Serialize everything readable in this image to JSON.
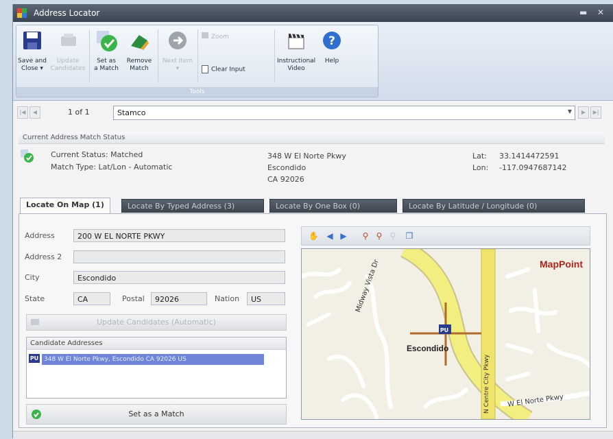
{
  "window": {
    "title": "Address Locator"
  },
  "ribbon": {
    "buttons": [
      {
        "label1": "Save and",
        "label2": "Close ▾"
      },
      {
        "label1": "Update",
        "label2": "Candidates"
      },
      {
        "label1": "Set as",
        "label2": "a Match"
      },
      {
        "label1": "Remove",
        "label2": "Match"
      },
      {
        "label1": "Next Item",
        "label2": "▾"
      },
      {
        "label1": "Instructional",
        "label2": "Video"
      },
      {
        "label1": "Help",
        "label2": ""
      }
    ],
    "zoom_label": "Zoom",
    "clear_input_label": "Clear Input",
    "group_label": "Tools"
  },
  "nav": {
    "pager": "1 of 1",
    "record": "Stamco"
  },
  "status": {
    "section_title": "Current Address Match Status",
    "current_status": "Current Status: Matched",
    "match_type": "Match Type: Lat/Lon - Automatic",
    "addr_line1": "348 W El Norte Pkwy",
    "addr_line2": "Escondido",
    "addr_line3": "CA 92026",
    "lat_label": "Lat:",
    "lat_value": "33.1414472591",
    "lon_label": "Lon:",
    "lon_value": "-117.0947687142"
  },
  "tabs": [
    "Locate On Map (1)",
    "Locate By Typed Address (3)",
    "Locate By One Box (0)",
    "Locate By Latitude / Longitude (0)"
  ],
  "form": {
    "address_label": "Address",
    "address_value": "200 W EL NORTE PKWY",
    "address2_label": "Address 2",
    "address2_value": "",
    "city_label": "City",
    "city_value": "Escondido",
    "state_label": "State",
    "state_value": "CA",
    "postal_label": "Postal",
    "postal_value": "92026",
    "nation_label": "Nation",
    "nation_value": "US",
    "update_button": "Update Candidates (Automatic)"
  },
  "candidates": {
    "header": "Candidate Addresses",
    "items": [
      "348 W El Norte Pkwy, Escondido CA 92026 US"
    ]
  },
  "set_match_button": "Set as a Match",
  "map": {
    "brand": "MapPoint",
    "city_label": "Escondido",
    "street1": "Midway Vista Dr",
    "street2": "N Centre City Pkwy",
    "street3": "W El Norte Pkwy"
  },
  "colors": {
    "accent": "#6f86d8",
    "road": "#f3ee80"
  }
}
